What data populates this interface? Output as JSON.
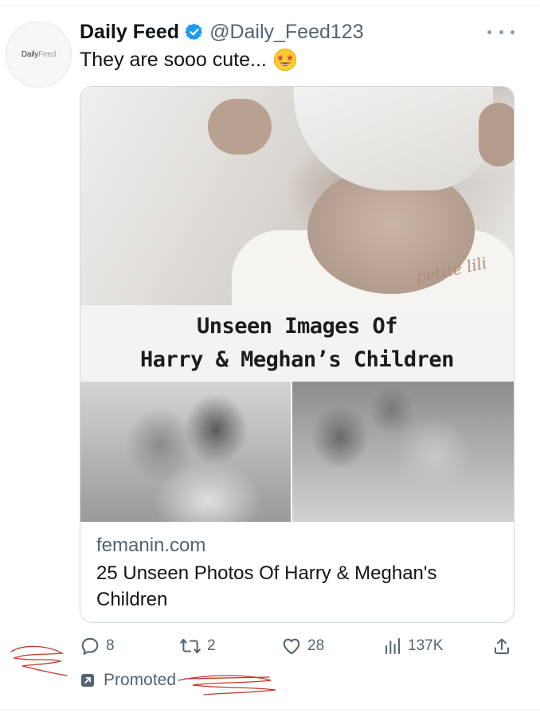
{
  "tweet": {
    "avatar_text_a": "Daily",
    "avatar_text_b": "Feed",
    "display_name": "Daily Feed",
    "handle": "@Daily_Feed123",
    "text": "They are sooo cute...",
    "emoji_icon": "star-struck-emoji-icon"
  },
  "card": {
    "image_overlay_line1": "Unseen Images Of",
    "image_overlay_line2": "Harry & Meghan’s Children",
    "onesie_print": "petite lili",
    "domain": "femanin.com",
    "title": "25 Unseen Photos Of Harry & Meghan's Children"
  },
  "actions": {
    "replies": "8",
    "reposts": "2",
    "likes": "28",
    "views": "137K"
  },
  "promoted": {
    "label": "Promoted"
  },
  "colors": {
    "primary_text": "#0f1419",
    "secondary_text": "#536471",
    "verified_blue": "#1d9bf0",
    "border": "#cfd9de",
    "scribble_red": "#c0392b"
  }
}
